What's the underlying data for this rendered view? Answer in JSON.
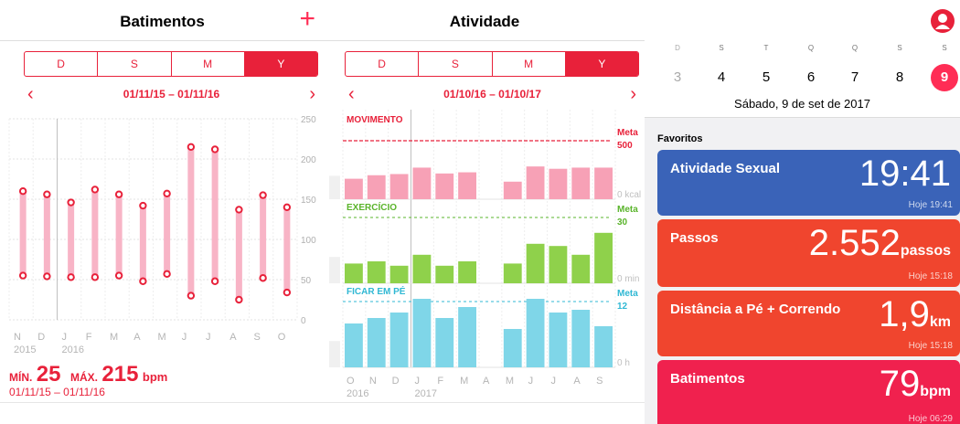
{
  "heart": {
    "title": "Batimentos",
    "add_icon": "+",
    "segments": [
      "D",
      "S",
      "M",
      "Y"
    ],
    "active_segment": "Y",
    "range": "01/11/15 – 01/11/16",
    "prev": "‹",
    "next": "›",
    "yticks": [
      "250",
      "200",
      "150",
      "100",
      "50",
      "0"
    ],
    "months": [
      "N",
      "D",
      "J",
      "F",
      "M",
      "A",
      "M",
      "J",
      "J",
      "A",
      "S",
      "O"
    ],
    "years": [
      "2015",
      "2016"
    ],
    "chart_data": {
      "type": "bar",
      "categories": [
        "N",
        "D",
        "J",
        "F",
        "M",
        "A",
        "M",
        "J",
        "J",
        "A",
        "S",
        "O"
      ],
      "ylim": [
        0,
        250
      ],
      "series": [
        {
          "name": "min",
          "values": [
            55,
            54,
            53,
            53,
            55,
            48,
            57,
            30,
            48,
            25,
            52,
            34
          ]
        },
        {
          "name": "max",
          "values": [
            160,
            156,
            146,
            162,
            156,
            142,
            157,
            215,
            212,
            137,
            155,
            140
          ]
        }
      ]
    },
    "stats": {
      "min_label": "MÍN.",
      "min_value": "25",
      "max_label": "MÁX.",
      "max_value": "215",
      "unit": "bpm",
      "period": "01/11/15 – 01/11/16"
    }
  },
  "activity": {
    "title": "Atividade",
    "segments": [
      "D",
      "S",
      "M",
      "Y"
    ],
    "active_segment": "Y",
    "range": "01/10/16 – 01/10/17",
    "prev": "‹",
    "next": "›",
    "months": [
      "O",
      "N",
      "D",
      "J",
      "F",
      "M",
      "A",
      "M",
      "J",
      "J",
      "A",
      "S"
    ],
    "years": [
      "2016",
      "2017"
    ],
    "colors": {
      "move": "#f7a1b6",
      "exercise": "#8fd14b",
      "stand": "#7fd6e8",
      "move_label": "#e8213a",
      "exercise_label": "#5ab42b",
      "stand_label": "#30b8d4"
    },
    "chart_data": [
      {
        "type": "bar",
        "name": "MOVIMENTO",
        "goal_label": "Meta",
        "goal": "500",
        "axis_label": "0 kcal",
        "ylim": [
          0,
          650
        ],
        "categories": [
          "O",
          "N",
          "D",
          "J",
          "F",
          "M",
          "A",
          "M",
          "J",
          "J",
          "A",
          "S"
        ],
        "values": [
          175,
          205,
          215,
          270,
          220,
          230,
          null,
          150,
          280,
          260,
          270,
          270
        ]
      },
      {
        "type": "bar",
        "name": "EXERCÍCIO",
        "goal_label": "Meta",
        "goal": "30",
        "axis_label": "0 min",
        "ylim": [
          0,
          40
        ],
        "categories": [
          "O",
          "N",
          "D",
          "J",
          "F",
          "M",
          "A",
          "M",
          "J",
          "J",
          "A",
          "S"
        ],
        "values": [
          9,
          10,
          8,
          13,
          8,
          10,
          null,
          9,
          18,
          17,
          13,
          23
        ]
      },
      {
        "type": "bar",
        "name": "FICAR EM PÉ",
        "goal_label": "Meta",
        "goal": "12",
        "axis_label": "0 h",
        "ylim": [
          0,
          14
        ],
        "categories": [
          "O",
          "N",
          "D",
          "J",
          "F",
          "M",
          "A",
          "M",
          "J",
          "J",
          "A",
          "S"
        ],
        "values": [
          8,
          9,
          10,
          12.5,
          9,
          11,
          null,
          7,
          12.5,
          10,
          10.5,
          7.5
        ]
      }
    ]
  },
  "summary": {
    "week_letters": [
      "D",
      "S",
      "T",
      "Q",
      "Q",
      "S",
      "S"
    ],
    "week_numbers": [
      "3",
      "4",
      "5",
      "6",
      "7",
      "8",
      "9"
    ],
    "selected_index": 6,
    "date": "Sábado, 9 de set de 2017",
    "favorites_title": "Favoritos",
    "cards": [
      {
        "name": "Atividade Sexual",
        "value": "19:41",
        "unit": "",
        "time": "Hoje 19:41",
        "color": "#3a63b8"
      },
      {
        "name": "Passos",
        "value": "2.552",
        "unit": "passos",
        "time": "Hoje 15:18",
        "color": "#f0452e"
      },
      {
        "name": "Distância a Pé + Correndo",
        "value": "1,9",
        "unit": "km",
        "time": "Hoje 15:18",
        "color": "#f0452e"
      },
      {
        "name": "Batimentos",
        "value": "79",
        "unit": "bpm",
        "time": "Hoje 06:29",
        "color": "#f0214e"
      }
    ]
  }
}
